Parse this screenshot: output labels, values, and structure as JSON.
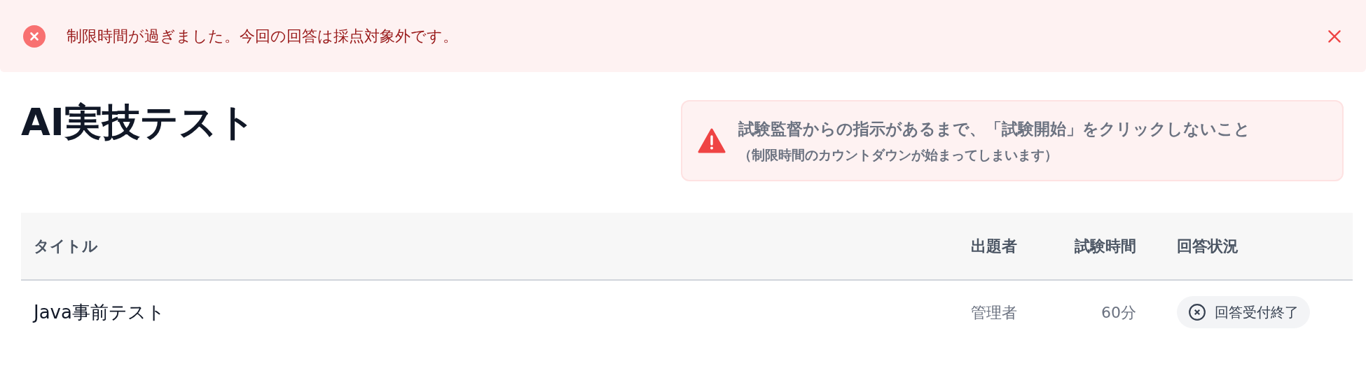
{
  "alert": {
    "kind": "error",
    "message": "制限時間が過ぎました。今回の回答は採点対象外です。"
  },
  "page_title": "AI実技テスト",
  "warning": {
    "line_1": "試験監督からの指示があるまで、「試験開始」をクリックしないこと",
    "line_2": "（制限時間のカウントダウンが始まってしまいます）"
  },
  "table": {
    "columns": [
      "タイトル",
      "出題者",
      "試験時間",
      "回答状況"
    ],
    "rows": [
      {
        "title": "Java事前テスト",
        "author": "管理者",
        "duration": "60分",
        "status": {
          "kind": "closed",
          "label": "回答受付終了"
        }
      }
    ]
  }
}
